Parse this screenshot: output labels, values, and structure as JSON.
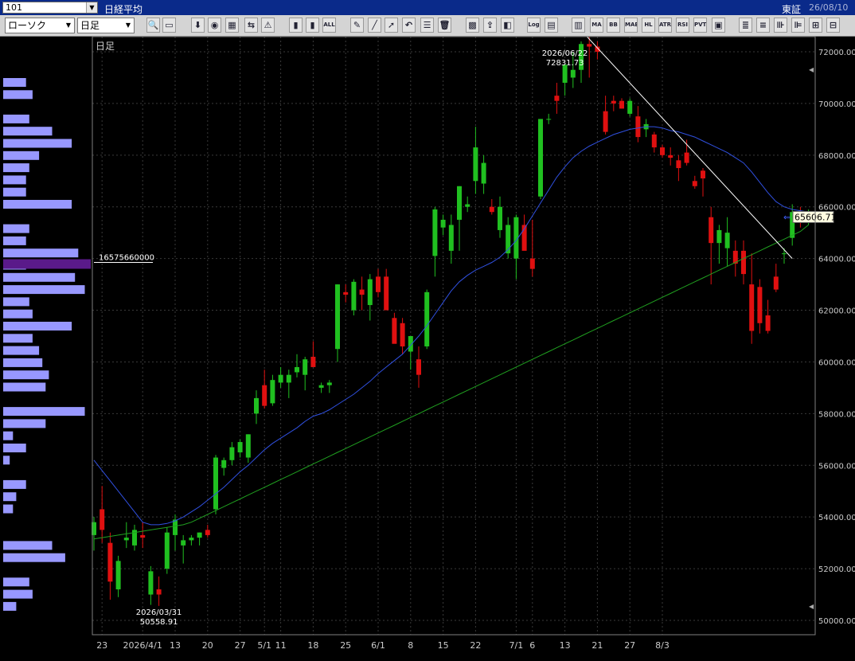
{
  "window": {
    "code": "101",
    "title": "日経平均",
    "exchange": "東証",
    "date": "26/08/10"
  },
  "toolbar": {
    "chart_type": "ローソク",
    "period": "日足",
    "buttons": [
      "Log",
      "MA",
      "BB",
      "MAE",
      "HL",
      "ATR",
      "RSI",
      "PVT"
    ]
  },
  "chart_data": {
    "type": "candlestick",
    "period_label": "日足",
    "current_price_label": "65606.71",
    "high_annotation": {
      "date": "2026/06/22",
      "value": "72831.73"
    },
    "low_annotation": {
      "date": "2026/03/31",
      "value": "50558.91"
    },
    "volume_marker": "16575660000",
    "ylim": [
      49300,
      74000
    ],
    "yticks": [
      "72000.00",
      "70000.00",
      "68000.00",
      "66000.00",
      "64000.00",
      "62000.00",
      "60000.00",
      "58000.00",
      "56000.00",
      "54000.00",
      "52000.00",
      "50000.00"
    ],
    "xticks": [
      {
        "i": 1,
        "label": "23"
      },
      {
        "i": 6,
        "label": "2026/4/1"
      },
      {
        "i": 10,
        "label": "13"
      },
      {
        "i": 14,
        "label": "20"
      },
      {
        "i": 18,
        "label": "27"
      },
      {
        "i": 21,
        "label": "5/1"
      },
      {
        "i": 23,
        "label": "11"
      },
      {
        "i": 27,
        "label": "18"
      },
      {
        "i": 31,
        "label": "25"
      },
      {
        "i": 35,
        "label": "6/1"
      },
      {
        "i": 39,
        "label": "8"
      },
      {
        "i": 43,
        "label": "15"
      },
      {
        "i": 47,
        "label": "22"
      },
      {
        "i": 52,
        "label": "7/1"
      },
      {
        "i": 54,
        "label": "6"
      },
      {
        "i": 58,
        "label": "13"
      },
      {
        "i": 62,
        "label": "21"
      },
      {
        "i": 66,
        "label": "27"
      },
      {
        "i": 70,
        "label": "8/3"
      }
    ],
    "candles": [
      [
        53300,
        54000,
        52700,
        53800
      ],
      [
        54300,
        55200,
        53000,
        53500
      ],
      [
        53000,
        53400,
        50800,
        51500
      ],
      [
        51200,
        52500,
        50900,
        52300
      ],
      [
        53100,
        53800,
        52800,
        53200
      ],
      [
        52900,
        53700,
        52700,
        53500
      ],
      [
        53300,
        53800,
        52800,
        53200
      ],
      [
        51000,
        52100,
        50600,
        51900
      ],
      [
        51200,
        51700,
        50559,
        51000
      ],
      [
        52000,
        53600,
        51800,
        53400
      ],
      [
        53300,
        54100,
        52700,
        53900
      ],
      [
        52900,
        53300,
        52200,
        53100
      ],
      [
        53100,
        53300,
        52900,
        53200
      ],
      [
        53200,
        53400,
        52900,
        53400
      ],
      [
        53500,
        53700,
        53200,
        53300
      ],
      [
        54300,
        56400,
        54100,
        56300
      ],
      [
        55900,
        56300,
        55600,
        56200
      ],
      [
        56200,
        56900,
        56000,
        56700
      ],
      [
        56500,
        57000,
        56300,
        56900
      ],
      [
        56300,
        57200,
        56100,
        57200
      ],
      [
        58000,
        58900,
        57600,
        58600
      ],
      [
        59100,
        59700,
        58200,
        58300
      ],
      [
        58400,
        59500,
        58300,
        59300
      ],
      [
        59200,
        59800,
        59000,
        59500
      ],
      [
        59200,
        59700,
        58600,
        59500
      ],
      [
        59600,
        60300,
        59400,
        59800
      ],
      [
        59500,
        60200,
        58900,
        60100
      ],
      [
        60200,
        60800,
        59900,
        59800
      ],
      [
        59000,
        59200,
        58800,
        59100
      ],
      [
        59100,
        59300,
        58800,
        59200
      ],
      [
        60500,
        63000,
        60000,
        63000
      ],
      [
        62700,
        63000,
        62300,
        62600
      ],
      [
        62000,
        63200,
        61800,
        63100
      ],
      [
        62800,
        63300,
        62000,
        62600
      ],
      [
        62200,
        63400,
        61600,
        63200
      ],
      [
        63300,
        63600,
        62500,
        62700
      ],
      [
        63300,
        63600,
        62300,
        62000
      ],
      [
        61700,
        61900,
        61100,
        60700
      ],
      [
        61500,
        61700,
        60300,
        60600
      ],
      [
        60400,
        61000,
        59700,
        61000
      ],
      [
        60100,
        60600,
        59000,
        59500
      ],
      [
        60600,
        62800,
        60500,
        62700
      ],
      [
        64100,
        66000,
        63300,
        65900
      ],
      [
        65200,
        65700,
        64900,
        65500
      ],
      [
        64300,
        65700,
        63800,
        65300
      ],
      [
        65500,
        66800,
        64300,
        66800
      ],
      [
        66000,
        66400,
        65800,
        66100
      ],
      [
        67000,
        69100,
        66500,
        68300
      ],
      [
        66900,
        68000,
        66500,
        67700
      ],
      [
        66000,
        66300,
        65700,
        65800
      ],
      [
        65100,
        66400,
        64800,
        66000
      ],
      [
        64200,
        65600,
        64000,
        65300
      ],
      [
        64000,
        65700,
        63200,
        65600
      ],
      [
        65300,
        65700,
        64600,
        64300
      ],
      [
        64000,
        65500,
        63300,
        63600
      ],
      [
        66400,
        67900,
        66300,
        69400
      ],
      [
        69400,
        69600,
        69200,
        69400
      ],
      [
        70300,
        70800,
        69600,
        70100
      ],
      [
        70800,
        71400,
        70300,
        71500
      ],
      [
        71000,
        72000,
        70600,
        71300
      ],
      [
        71300,
        72400,
        70800,
        72300
      ],
      [
        72300,
        72800,
        71000,
        72200
      ],
      [
        72200,
        72400,
        71700,
        72000
      ],
      [
        69700,
        70300,
        68800,
        68900
      ],
      [
        70100,
        70300,
        69700,
        70000
      ],
      [
        70100,
        70200,
        69800,
        69800
      ],
      [
        69600,
        70200,
        69500,
        70100
      ],
      [
        69500,
        69900,
        68500,
        68700
      ],
      [
        69000,
        69400,
        68700,
        69200
      ],
      [
        68800,
        68900,
        68100,
        68300
      ],
      [
        68300,
        68400,
        67900,
        68000
      ],
      [
        68000,
        68300,
        67600,
        67900
      ],
      [
        67800,
        68000,
        67000,
        67500
      ],
      [
        68100,
        68600,
        67600,
        67700
      ],
      [
        67000,
        67200,
        66700,
        66800
      ],
      [
        67400,
        67500,
        66400,
        67100
      ],
      [
        65600,
        66000,
        63000,
        64600
      ],
      [
        64600,
        65300,
        63800,
        65100
      ],
      [
        64400,
        65600,
        63700,
        65000
      ],
      [
        64300,
        64700,
        63300,
        63800
      ],
      [
        64300,
        64700,
        63000,
        63400
      ],
      [
        63000,
        64200,
        60700,
        61200
      ],
      [
        62900,
        63200,
        61100,
        61500
      ],
      [
        61800,
        62400,
        61100,
        61200
      ],
      [
        63300,
        63800,
        62700,
        62800
      ],
      [
        64200,
        64400,
        63800,
        64200
      ],
      [
        64800,
        66100,
        64500,
        65800
      ],
      [
        65800,
        66000,
        65200,
        65700
      ],
      [
        65500,
        65900,
        65300,
        65607
      ]
    ],
    "ma_short": [
      56200,
      55800,
      55400,
      55000,
      54600,
      54200,
      53800,
      53700,
      53700,
      53750,
      53850,
      54000,
      54200,
      54400,
      54650,
      54900,
      55150,
      55450,
      55750,
      56000,
      56300,
      56600,
      56850,
      57050,
      57250,
      57450,
      57700,
      57900,
      58000,
      58150,
      58350,
      58550,
      58750,
      59000,
      59250,
      59550,
      59800,
      60050,
      60300,
      60650,
      61000,
      61400,
      61850,
      62300,
      62750,
      63100,
      63350,
      63550,
      63700,
      63850,
      64050,
      64350,
      64700,
      65150,
      65650,
      66150,
      66650,
      67150,
      67550,
      67900,
      68150,
      68350,
      68500,
      68650,
      68800,
      68900,
      69000,
      69050,
      69100,
      69100,
      69050,
      68950,
      68900,
      68800,
      68700,
      68550,
      68400,
      68250,
      68100,
      67900,
      67700,
      67350,
      66950,
      66550,
      66200,
      66000,
      65900,
      65850,
      65800
    ],
    "ma_long": [
      53150,
      53200,
      53250,
      53300,
      53350,
      53400,
      53450,
      53500,
      53550,
      53600,
      53650,
      53700,
      53800,
      53950,
      54100,
      54250,
      54400,
      54550,
      54700,
      54850,
      55000,
      55150,
      55300,
      55450,
      55600,
      55750,
      55900,
      56050,
      56200,
      56350,
      56500,
      56650,
      56800,
      56950,
      57100,
      57250,
      57400,
      57550,
      57700,
      57850,
      58000,
      58150,
      58300,
      58450,
      58600,
      58750,
      58900,
      59050,
      59200,
      59350,
      59500,
      59650,
      59800,
      59950,
      60100,
      60250,
      60400,
      60550,
      60700,
      60850,
      61000,
      61150,
      61300,
      61450,
      61600,
      61750,
      61900,
      62050,
      62200,
      62350,
      62500,
      62650,
      62800,
      62950,
      63100,
      63250,
      63400,
      63550,
      63700,
      63850,
      64000,
      64150,
      64300,
      64450,
      64600,
      64750,
      64900,
      65050,
      65300
    ],
    "volume_bars": [
      7,
      9,
      0,
      8,
      15,
      21,
      11,
      8,
      7,
      7,
      21,
      0,
      8,
      7,
      23,
      7,
      22,
      25,
      8,
      9,
      21,
      9,
      11,
      12,
      14,
      13,
      0,
      25,
      13,
      3,
      7,
      2,
      0,
      7,
      4,
      3,
      0,
      0,
      15,
      19,
      0,
      8,
      9,
      4
    ],
    "colors": {
      "up": "#20c020",
      "down": "#e01010",
      "ma_short": "#3050e0",
      "ma_long": "#20a020",
      "trendline": "#ffffff",
      "volume": "#9898ff",
      "volume_highlight": "#5a1a8a",
      "price_label_bg": "#fffbe0"
    }
  }
}
